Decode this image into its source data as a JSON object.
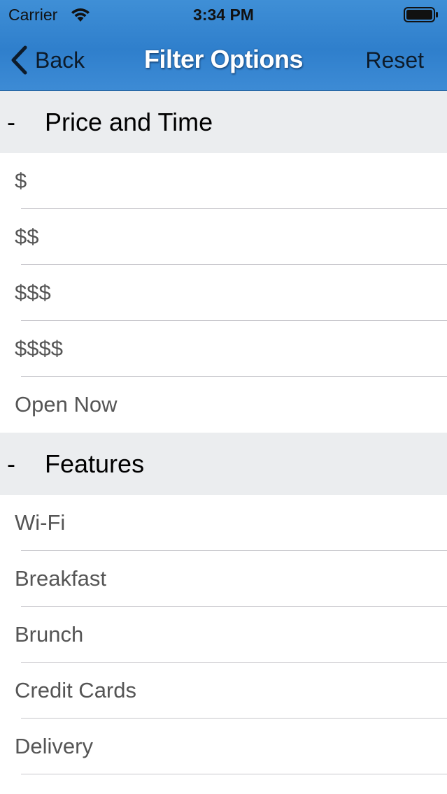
{
  "status_bar": {
    "carrier": "Carrier",
    "time": "3:34 PM",
    "wifi_icon": "wifi-icon",
    "battery_icon": "battery-icon"
  },
  "nav": {
    "back_label": "Back",
    "title": "Filter Options",
    "reset_label": "Reset",
    "accent_color": "#3a88d2"
  },
  "sections": [
    {
      "toggle": "-",
      "title": "Price and Time",
      "items": [
        "$",
        "$$",
        "$$$",
        "$$$$",
        "Open Now"
      ]
    },
    {
      "toggle": "-",
      "title": "Features",
      "items": [
        "Wi-Fi",
        "Breakfast",
        "Brunch",
        "Credit Cards",
        "Delivery"
      ]
    }
  ]
}
